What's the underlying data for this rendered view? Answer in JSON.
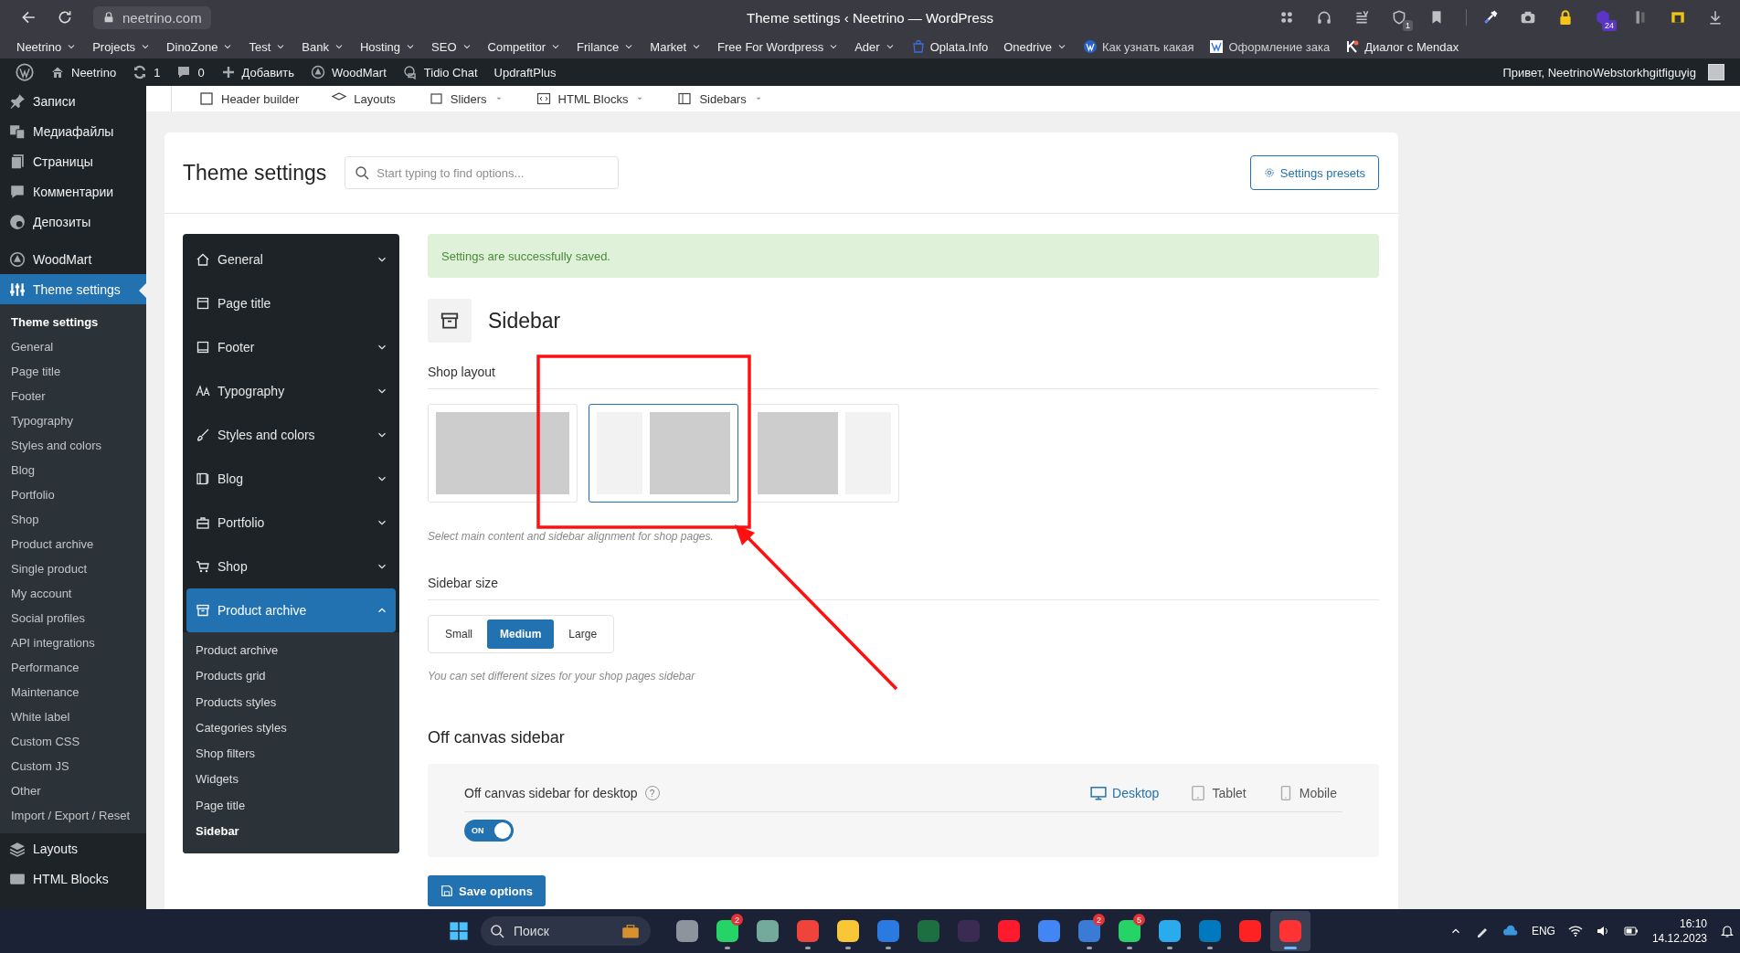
{
  "browser": {
    "url": "neetrino.com",
    "title": "Theme settings ‹ Neetrino — WordPress",
    "extensions": [
      {
        "kind": "dots"
      },
      {
        "kind": "headphones"
      },
      {
        "kind": "reader"
      },
      {
        "kind": "shield",
        "badge": "1"
      },
      {
        "kind": "bookmark"
      },
      {
        "kind": "eyedropper"
      },
      {
        "kind": "camera"
      },
      {
        "kind": "lock"
      },
      {
        "kind": "hexagon",
        "badge": "24"
      },
      {
        "kind": "bars"
      },
      {
        "kind": "note"
      },
      {
        "kind": "download"
      }
    ]
  },
  "bookmarks": [
    {
      "label": "Neetrino",
      "kind": "folder"
    },
    {
      "label": "Projects",
      "kind": "folder"
    },
    {
      "label": "DinoZone",
      "kind": "folder"
    },
    {
      "label": "Test",
      "kind": "folder"
    },
    {
      "label": "Bank",
      "kind": "folder"
    },
    {
      "label": "Hosting",
      "kind": "folder"
    },
    {
      "label": "SEO",
      "kind": "folder"
    },
    {
      "label": "Competitor",
      "kind": "folder"
    },
    {
      "label": "Frilance",
      "kind": "folder"
    },
    {
      "label": "Market",
      "kind": "folder"
    },
    {
      "label": "Free For Wordpress",
      "kind": "folder"
    },
    {
      "label": "Ader",
      "kind": "folder"
    },
    {
      "label": "Oplata.Info",
      "kind": "bag"
    },
    {
      "label": "Onedrive",
      "kind": "folder"
    },
    {
      "label": "Как узнать какая",
      "kind": "wp"
    },
    {
      "label": "Оформление зака",
      "kind": "site"
    },
    {
      "label": "Диалог с Mendax",
      "kind": "k"
    }
  ],
  "admin_bar": {
    "items": [
      {
        "label": "Neetrino",
        "kind": "home"
      },
      {
        "label": "1",
        "kind": "updates"
      },
      {
        "label": "0",
        "kind": "comments"
      },
      {
        "label": "Добавить",
        "kind": "new"
      },
      {
        "label": "WoodMart",
        "kind": "woodmart"
      },
      {
        "label": "Tidio Chat",
        "kind": "tidio"
      },
      {
        "label": "UpdraftPlus",
        "kind": "plain"
      }
    ],
    "greeting": "Привет, NeetrinoWebstorkhgitfiguyig"
  },
  "admin_menu": {
    "groups": [
      {
        "items": [
          {
            "label": "Записи",
            "kind": "pin",
            "selected": false
          },
          {
            "label": "Медиафайлы",
            "kind": "media",
            "selected": false
          },
          {
            "label": "Страницы",
            "kind": "pages",
            "selected": false
          },
          {
            "label": "Комментарии",
            "kind": "comment",
            "selected": false
          },
          {
            "label": "Депозиты",
            "kind": "coins",
            "selected": false
          }
        ]
      },
      {
        "items": [
          {
            "label": "WoodMart",
            "kind": "woodmart",
            "selected": false
          },
          {
            "label": "Theme settings",
            "kind": "sliders",
            "selected": true,
            "children": [
              {
                "label": "Theme settings",
                "selected": true
              },
              {
                "label": "General",
                "selected": false
              },
              {
                "label": "Page title",
                "selected": false
              },
              {
                "label": "Footer",
                "selected": false
              },
              {
                "label": "Typography",
                "selected": false
              },
              {
                "label": "Styles and colors",
                "selected": false
              },
              {
                "label": "Blog",
                "selected": false
              },
              {
                "label": "Portfolio",
                "selected": false
              },
              {
                "label": "Shop",
                "selected": false
              },
              {
                "label": "Product archive",
                "selected": false
              },
              {
                "label": "Single product",
                "selected": false
              },
              {
                "label": "My account",
                "selected": false
              },
              {
                "label": "Social profiles",
                "selected": false
              },
              {
                "label": "API integrations",
                "selected": false
              },
              {
                "label": "Performance",
                "selected": false
              },
              {
                "label": "Maintenance",
                "selected": false
              },
              {
                "label": "White label",
                "selected": false
              },
              {
                "label": "Custom CSS",
                "selected": false
              },
              {
                "label": "Custom JS",
                "selected": false
              },
              {
                "label": "Other",
                "selected": false
              },
              {
                "label": "Import / Export / Reset",
                "selected": false
              }
            ]
          },
          {
            "label": "Layouts",
            "kind": "layers",
            "selected": false
          },
          {
            "label": "HTML Blocks",
            "kind": "block",
            "selected": false
          }
        ]
      }
    ]
  },
  "top_menu": [
    {
      "label": "Header builder",
      "dropdown": false
    },
    {
      "label": "Layouts",
      "dropdown": false
    },
    {
      "label": "Sliders",
      "dropdown": true
    },
    {
      "label": "HTML Blocks",
      "dropdown": true
    },
    {
      "label": "Sidebars",
      "dropdown": true
    }
  ],
  "settings": {
    "title": "Theme settings",
    "search": {
      "placeholder": "Start typing to find options..."
    },
    "presets_button": "Settings presets",
    "nav": [
      {
        "label": "General",
        "expandable": true,
        "expanded": false,
        "selected": false
      },
      {
        "label": "Page title",
        "expandable": false,
        "selected": false
      },
      {
        "label": "Footer",
        "expandable": true,
        "expanded": false,
        "selected": false
      },
      {
        "label": "Typography",
        "expandable": true,
        "expanded": false,
        "selected": false
      },
      {
        "label": "Styles and colors",
        "expandable": true,
        "expanded": false,
        "selected": false
      },
      {
        "label": "Blog",
        "expandable": true,
        "expanded": false,
        "selected": false
      },
      {
        "label": "Portfolio",
        "expandable": true,
        "expanded": false,
        "selected": false
      },
      {
        "label": "Shop",
        "expandable": true,
        "expanded": false,
        "selected": false
      },
      {
        "label": "Product archive",
        "expandable": true,
        "expanded": true,
        "selected": true,
        "children": [
          {
            "label": "Product archive",
            "selected": false
          },
          {
            "label": "Products grid",
            "selected": false
          },
          {
            "label": "Products styles",
            "selected": false
          },
          {
            "label": "Categories styles",
            "selected": false
          },
          {
            "label": "Shop filters",
            "selected": false
          },
          {
            "label": "Widgets",
            "selected": false
          },
          {
            "label": "Page title",
            "selected": false
          },
          {
            "label": "Sidebar",
            "selected": true
          }
        ]
      }
    ],
    "notice": "Settings are successfully saved.",
    "section_title": "Sidebar",
    "shop_layout": {
      "label": "Shop layout",
      "options": [
        {
          "kind": "no-sidebar",
          "selected": false
        },
        {
          "kind": "left-sidebar",
          "selected": true
        },
        {
          "kind": "right-sidebar",
          "selected": false
        }
      ],
      "hint": "Select main content and sidebar alignment for shop pages."
    },
    "sidebar_size": {
      "label": "Sidebar size",
      "options": [
        {
          "label": "Small",
          "selected": false
        },
        {
          "label": "Medium",
          "selected": true
        },
        {
          "label": "Large",
          "selected": false
        }
      ],
      "hint": "You can set different sizes for your shop pages sidebar"
    },
    "off_canvas": {
      "title": "Off canvas sidebar",
      "field_label": "Off canvas sidebar for desktop",
      "help": "?",
      "devices": [
        {
          "label": "Desktop",
          "selected": true
        },
        {
          "label": "Tablet",
          "selected": false
        },
        {
          "label": "Mobile",
          "selected": false
        }
      ],
      "toggle": {
        "on": true,
        "label": "ON"
      }
    },
    "save_button": "Save options"
  },
  "taskbar": {
    "search_placeholder": "Поиск",
    "apps": [
      {
        "color": "#8e949c",
        "running": false,
        "selected": false
      },
      {
        "color": "#25d366",
        "badge": "2",
        "running": true,
        "selected": false
      },
      {
        "color": "#74aa9c",
        "running": false,
        "selected": false
      },
      {
        "color": "#ef443b",
        "running": true,
        "selected": false
      },
      {
        "color": "#f8c637",
        "running": true,
        "selected": false
      },
      {
        "color": "#2a7ae2",
        "running": true,
        "selected": false
      },
      {
        "color": "#1d6f42",
        "running": false,
        "selected": false
      },
      {
        "color": "#3b2a52",
        "running": false,
        "selected": false
      },
      {
        "color": "#ff1b2d",
        "running": false,
        "selected": false
      },
      {
        "color": "#4285f4",
        "running": false,
        "selected": false
      },
      {
        "color": "#3a7bd5",
        "badge": "2",
        "running": true,
        "selected": false
      },
      {
        "color": "#25d366",
        "badge": "5",
        "running": true,
        "selected": false
      },
      {
        "color": "#2aabee",
        "running": true,
        "selected": false
      },
      {
        "color": "#0079bf",
        "running": true,
        "selected": false
      },
      {
        "color": "#ff2222",
        "running": false,
        "selected": false
      },
      {
        "color": "#ff3333",
        "running": true,
        "selected": true
      }
    ],
    "language": "ENG",
    "time": "16:10",
    "date": "14.12.2023"
  }
}
